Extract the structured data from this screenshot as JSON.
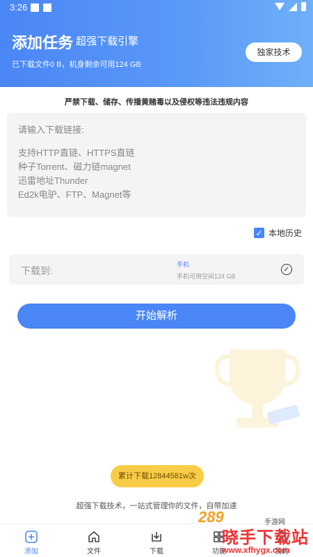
{
  "status_bar": {
    "time": "3:26"
  },
  "header": {
    "title": "添加任务",
    "subtitle": "- 超强下载引擎",
    "info": "已下载文件0 B，机身剩余可用124 GB",
    "button_label": "独家技术"
  },
  "warning": "严禁下载、储存、传播黄赌毒以及侵权等违法违规内容",
  "link_input": {
    "placeholder": "请输入下载链接:",
    "hints": [
      "支持HTTP直链、HTTPS直链",
      "种子Torrent、磁力链magnet",
      "迅雷地址Thunder",
      "Ed2k电驴、FTP、Magnet等"
    ]
  },
  "history": {
    "label": "本地历史",
    "checked": true
  },
  "download_to": {
    "label": "下载到:",
    "location": "手机",
    "space": "手机可用空间124 GB"
  },
  "parse_button": "开始解析",
  "counter": "累计下载12844581w次",
  "slogan": "超强下载技术，一站式管理你的文件，自带加速",
  "nav": [
    {
      "label": "添加",
      "icon": "add-icon",
      "active": true
    },
    {
      "label": "文件",
      "icon": "home-icon",
      "active": false
    },
    {
      "label": "下载",
      "icon": "download-icon",
      "active": false
    },
    {
      "label": "功能",
      "icon": "grid-icon",
      "active": false
    },
    {
      "label": "我的",
      "icon": "user-icon",
      "active": false
    }
  ],
  "watermark": {
    "number": "289",
    "com": ".com",
    "small": "手游网",
    "text": "晓手下载站",
    "url": "www.xfhygx.com"
  },
  "colors": {
    "accent": "#4a86f5",
    "counter_bg": "#f9cc48"
  }
}
